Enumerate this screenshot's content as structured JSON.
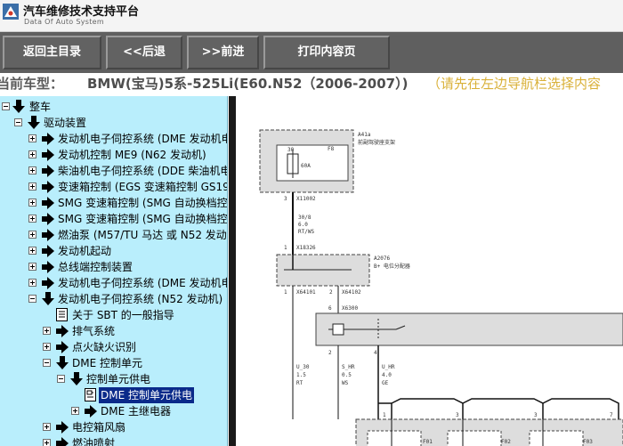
{
  "header": {
    "title": "汽车维修技术支持平台",
    "subtitle": "Data Of Auto System"
  },
  "toolbar": {
    "back_main": "返回主目录",
    "back": "<<后退",
    "forward": ">>前进",
    "print": "打印内容页"
  },
  "vehicle": {
    "label": "当前车型：",
    "model": "BMW(宝马)5系-525Li(E60.N52（2006-2007）)",
    "hint": "（请先在左边导航栏选择内容"
  },
  "tree": {
    "items": [
      {
        "label": "整车"
      },
      {
        "label": "驱动装置"
      },
      {
        "label": "发动机电子伺控系统 (DME 发动机电"
      },
      {
        "label": "发动机控制 ME9 (N62 发动机)"
      },
      {
        "label": "柴油机电子伺控系统 (DDE 柴油机电"
      },
      {
        "label": "变速箱控制 (EGS 变速箱控制 GS19"
      },
      {
        "label": "SMG 变速箱控制 (SMG 自动换档控"
      },
      {
        "label": "SMG 变速箱控制 (SMG 自动换档控"
      },
      {
        "label": "燃油泵 (M57/TU 马达 或 N52 发动机"
      },
      {
        "label": "发动机起动"
      },
      {
        "label": "总线端控制装置"
      },
      {
        "label": "发动机电子伺控系统 (DME 发动机电"
      },
      {
        "label": "发动机电子伺控系统 (N52 发动机)"
      },
      {
        "label": "关于 SBT 的一般指导"
      },
      {
        "label": "排气系统"
      },
      {
        "label": "点火缺火识别"
      },
      {
        "label": "DME 控制单元"
      },
      {
        "label": "控制单元供电"
      },
      {
        "label": "DME 控制单元供电"
      },
      {
        "label": "DME 主继电器"
      },
      {
        "label": "电控箱风扇"
      },
      {
        "label": "燃油喷射"
      }
    ]
  },
  "diagram": {
    "a41a": "A41a",
    "a41a_desc": "前副驾驶座支架",
    "f8": "F8",
    "fuse_pin": "30",
    "fuse_rating": "60A",
    "x11002": "X11002",
    "wire1_a": "30/8",
    "wire1_b": "6.0",
    "wire1_c": "RT/WS",
    "x18326": "X18326",
    "a2076": "A2076",
    "a2076_desc": "B+ 电位分配器",
    "x64101": "X64101",
    "x64102": "X64102",
    "x6300": "X6300",
    "w_u30": "U_30",
    "w_u30_b": "1.5",
    "w_u30_c": "RT",
    "w_shr": "S_HR",
    "w_shr_b": "0.5",
    "w_shr_c": "WS",
    "w_uhr": "U_HR",
    "w_uhr_b": "4.0",
    "w_uhr_c": "GE",
    "f01": "F01",
    "f02": "F02",
    "f03": "F03",
    "p1": "1",
    "p2": "2",
    "p3": "3",
    "p4": "4",
    "p6": "6",
    "p7": "7"
  },
  "colors": {
    "toolbar_bg": "#5f5f5f",
    "tree_bg": "#b9eefc",
    "selected_bg": "#0a2a8a",
    "hint_color": "#d9b038"
  }
}
